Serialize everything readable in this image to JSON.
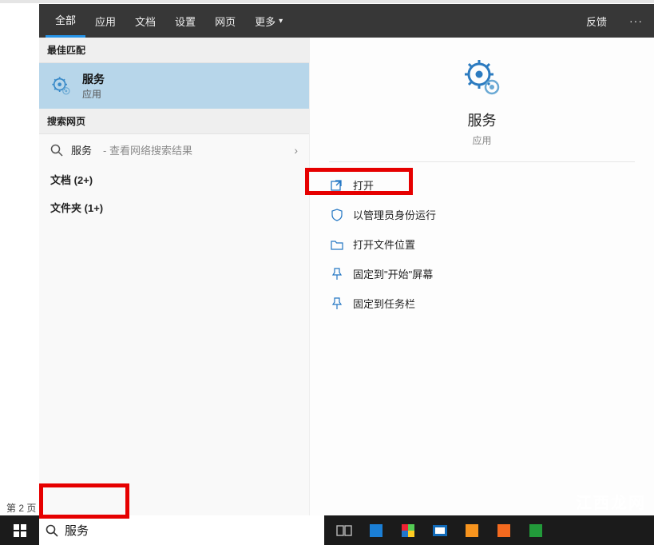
{
  "page_label": "第 2 页",
  "tabs": {
    "items": [
      {
        "label": "全部",
        "active": true
      },
      {
        "label": "应用",
        "active": false
      },
      {
        "label": "文档",
        "active": false
      },
      {
        "label": "设置",
        "active": false
      },
      {
        "label": "网页",
        "active": false
      }
    ],
    "more": "更多",
    "feedback": "反馈"
  },
  "left": {
    "best_match_header": "最佳匹配",
    "best_match": {
      "title": "服务",
      "subtitle": "应用"
    },
    "search_web_header": "搜索网页",
    "web_item": {
      "query": "服务",
      "hint": "- 查看网络搜索结果"
    },
    "docs": {
      "label": "文档",
      "count": "(2+)"
    },
    "folders": {
      "label": "文件夹",
      "count": "(1+)"
    }
  },
  "detail": {
    "title": "服务",
    "subtitle": "应用",
    "actions": [
      {
        "label": "打开",
        "icon": "open"
      },
      {
        "label": "以管理员身份运行",
        "icon": "admin"
      },
      {
        "label": "打开文件位置",
        "icon": "folder"
      },
      {
        "label": "固定到\"开始\"屏幕",
        "icon": "pin-start"
      },
      {
        "label": "固定到任务栏",
        "icon": "pin-taskbar"
      }
    ]
  },
  "taskbar": {
    "search_value": "服务"
  },
  "watermark": "江西龙网"
}
